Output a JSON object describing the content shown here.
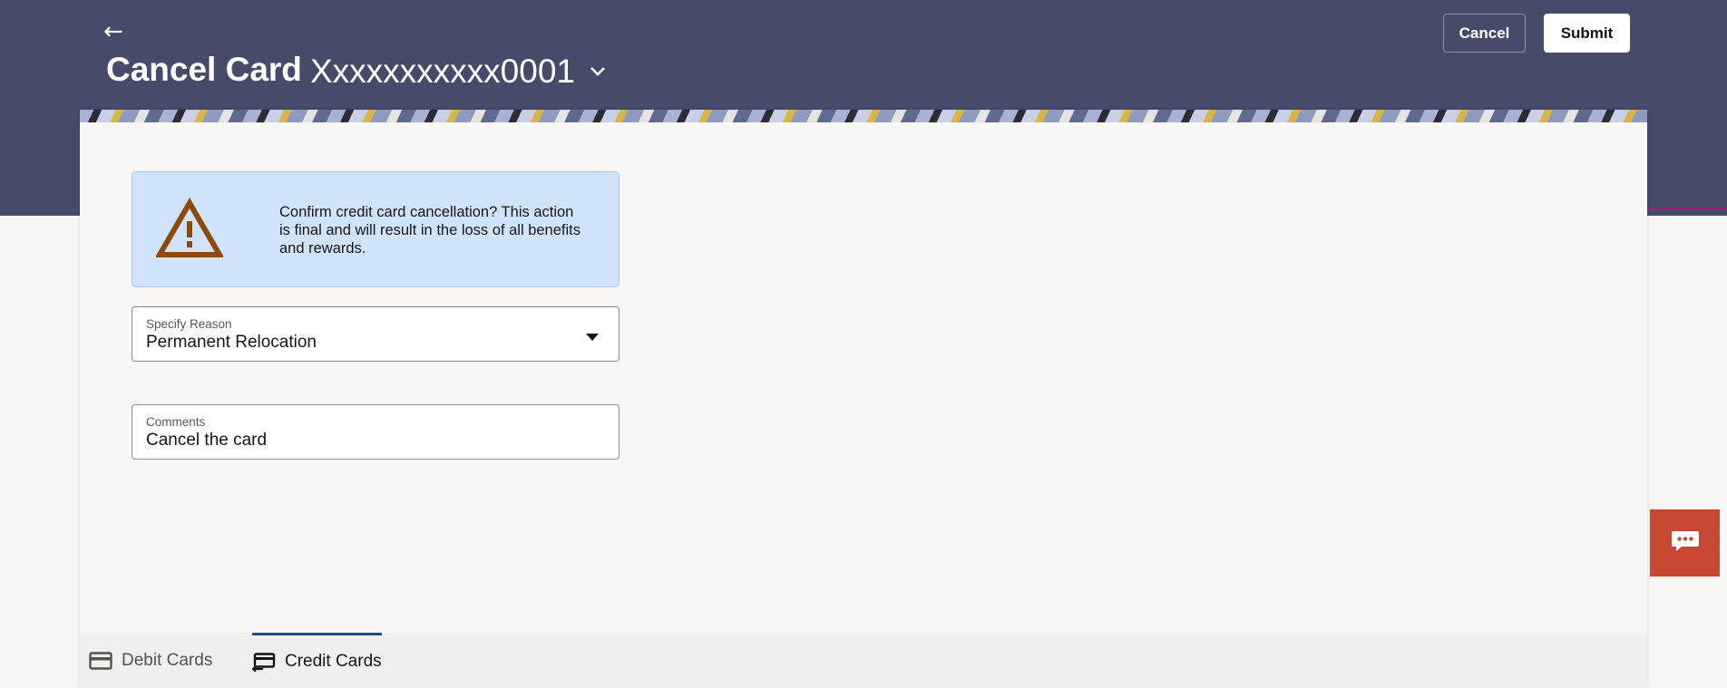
{
  "header": {
    "back_glyph": "←",
    "title": "Cancel Card",
    "card_number": "Xxxxxxxxxxx0001",
    "cancel_label": "Cancel",
    "submit_label": "Submit"
  },
  "alert": {
    "icon": "warning-triangle-icon",
    "message": "Confirm credit card cancellation? This action is final and will result in the loss of all benefits and rewards."
  },
  "form": {
    "reason": {
      "label": "Specify Reason",
      "value": "Permanent Relocation"
    },
    "comments": {
      "label": "Comments",
      "value": "Cancel the card"
    }
  },
  "tabs": [
    {
      "label": "Debit Cards",
      "icon": "card-icon",
      "active": false
    },
    {
      "label": "Credit Cards",
      "icon": "card-transfer-icon",
      "active": true
    }
  ],
  "chat": {
    "icon": "chat-bubble-icon"
  },
  "colors": {
    "header_bg": "#454b69",
    "alert_bg": "#cfe3fb",
    "warning_icon": "#8b4a0c",
    "chat_bg": "#c74634",
    "active_tab_accent": "#1f4e8c"
  }
}
